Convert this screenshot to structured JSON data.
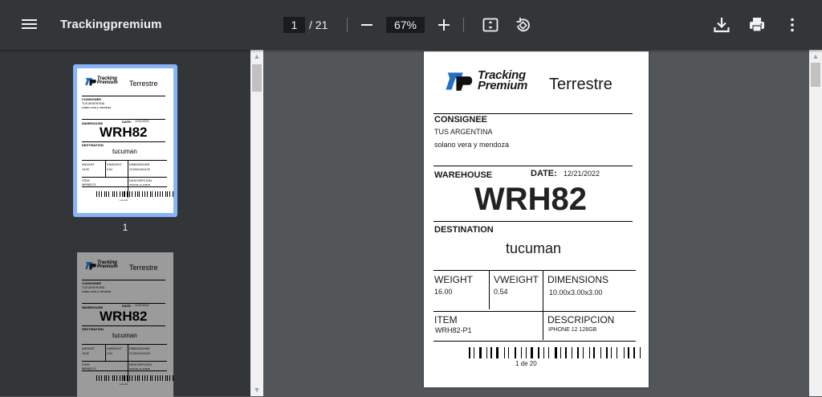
{
  "toolbar": {
    "title": "Trackingpremium",
    "page_current": "1",
    "page_total": "/ 21",
    "zoom": "67%"
  },
  "thumbnails": [
    {
      "number": "1",
      "selected": true
    },
    {
      "number": "",
      "selected": false
    }
  ],
  "label": {
    "logo_line1": "Tracking",
    "logo_line2": "Premium",
    "service": "Terrestre",
    "consignee_label": "CONSIGNEE",
    "consignee_name": "TUS ARGENTINA",
    "consignee_address": "solano vera y mendoza",
    "warehouse_label": "WAREHOUSE",
    "date_label": "DATE:",
    "date_value": "12/21/2022",
    "warehouse_number": "WRH82",
    "destination_label": "DESTINATION",
    "destination_value": "tucuman",
    "weight_label": "WEIGHT",
    "weight_value": "16.00",
    "vweight_label": "VWEIGHT",
    "vweight_value": "0.54",
    "dimensions_label": "DIMENSIONS",
    "dimensions_value": "10.00x3.00x3.00",
    "item_label": "ITEM",
    "item_value": "WRH82-P1",
    "description_label": "DESCRIPCION",
    "description_value": "IPHONE 12 128GB",
    "piece_count": "1 de 20"
  },
  "colors": {
    "toolbar_bg": "#323639",
    "viewer_bg": "#525659",
    "selection": "#8ab4f8",
    "logo_blue": "#1f6fc7"
  },
  "icons": [
    "menu-icon",
    "zoom-out-icon",
    "zoom-in-icon",
    "fit-page-icon",
    "rotate-icon",
    "download-icon",
    "print-icon",
    "more-vert-icon"
  ]
}
